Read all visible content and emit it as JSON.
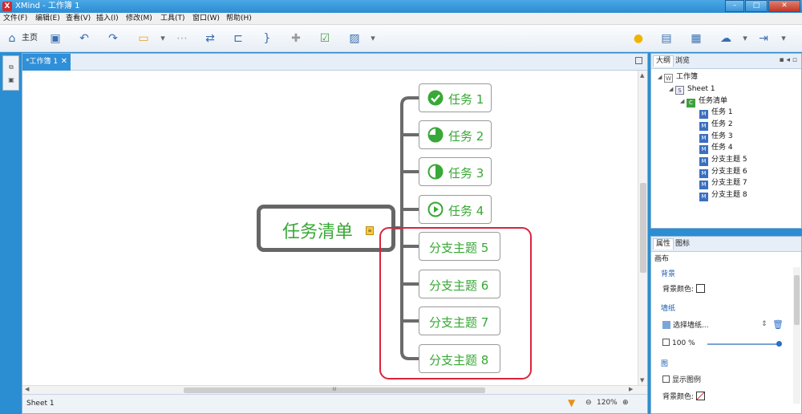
{
  "window": {
    "title": "XMind - 工作簿 1",
    "app_icon": "X",
    "controls": [
      "–",
      "□",
      "✕"
    ]
  },
  "menu": [
    "文件(F)",
    "编辑(E)",
    "查看(V)",
    "插入(I)",
    "修改(M)",
    "工具(T)",
    "窗口(W)",
    "帮助(H)"
  ],
  "toolbar": {
    "home_label": "主页"
  },
  "editor": {
    "tab_label": "*工作簿 1",
    "tab_close": "✕",
    "sheet_name": "Sheet 1",
    "zoom": "120%",
    "zoom_out": "⊖",
    "zoom_in": "⊕",
    "hscroll_grip": "III"
  },
  "map": {
    "central": "任务清单",
    "note_glyph": "≡",
    "tasks": [
      "任务 1",
      "任务 2",
      "任务 3",
      "任务 4"
    ],
    "task_icons": [
      "task-done-icon",
      "task-quarter-icon",
      "task-half-icon",
      "task-start-icon"
    ],
    "branches": [
      "分支主题 5",
      "分支主题 6",
      "分支主题 7",
      "分支主题 8"
    ],
    "colors": {
      "topic_text": "#38a836",
      "highlight": "#d9253b",
      "branch_line": "#6b6b6b"
    }
  },
  "outline": {
    "tabs": [
      "大纲",
      "浏览"
    ],
    "controls": "▪ ◂ ▫",
    "rows": [
      {
        "label": "工作簿",
        "icon": "workbook-icon",
        "glyph": "W"
      },
      {
        "label": "Sheet 1",
        "icon": "sheet-icon",
        "glyph": "S"
      },
      {
        "label": "任务清单",
        "icon": "central-topic-icon",
        "glyph": "C"
      },
      {
        "label": "任务 1",
        "icon": "main-topic-icon",
        "glyph": "M"
      },
      {
        "label": "任务 2",
        "icon": "main-topic-icon",
        "glyph": "M"
      },
      {
        "label": "任务 3",
        "icon": "main-topic-icon",
        "glyph": "M"
      },
      {
        "label": "任务 4",
        "icon": "main-topic-icon",
        "glyph": "M"
      },
      {
        "label": "分支主题 5",
        "icon": "main-topic-icon",
        "glyph": "M"
      },
      {
        "label": "分支主题 6",
        "icon": "main-topic-icon",
        "glyph": "M"
      },
      {
        "label": "分支主题 7",
        "icon": "main-topic-icon",
        "glyph": "M"
      },
      {
        "label": "分支主题 8",
        "icon": "main-topic-icon",
        "glyph": "M"
      }
    ]
  },
  "properties": {
    "tabs": [
      "属性",
      "图标"
    ],
    "heading": "画布",
    "background_section": "背景",
    "background_color_label": "背景颜色:",
    "wallpaper_section": "墙纸",
    "choose_wallpaper": "选择墙纸...",
    "opacity_value": "100",
    "opacity_unit": "%",
    "legend_section": "图",
    "show_legend": "显示图例",
    "legend_bg_label": "背景颜色:"
  }
}
